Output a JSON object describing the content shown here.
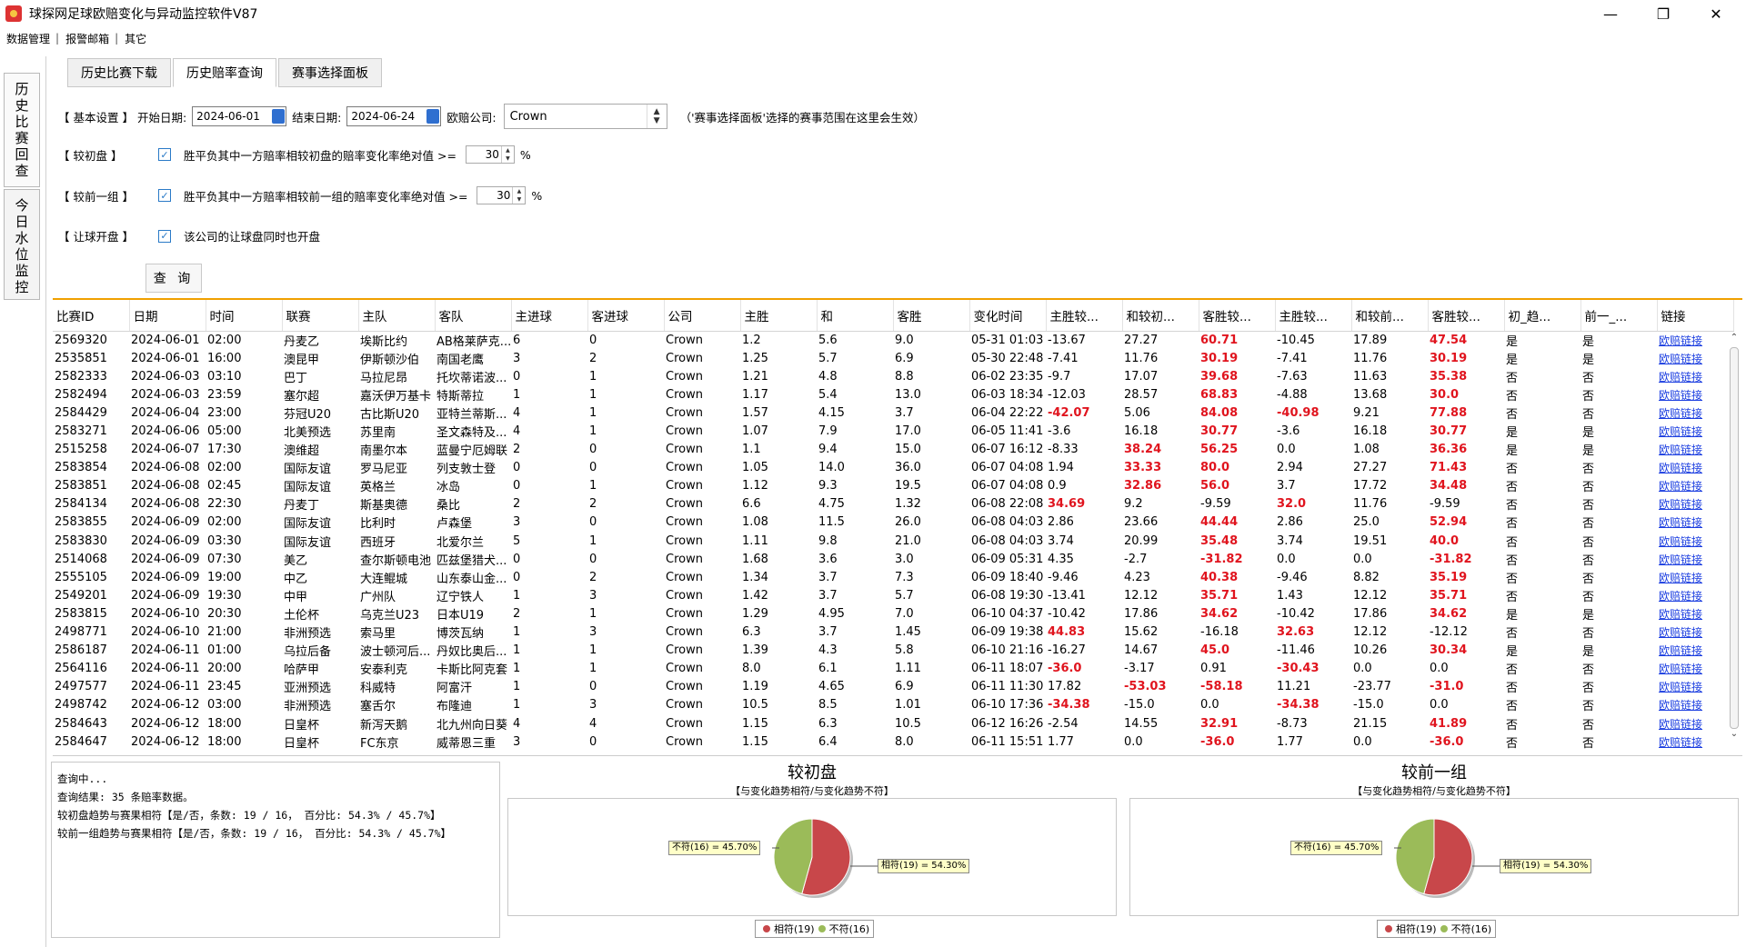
{
  "app": {
    "title": "球探网足球欧赔变化与异动监控软件V87"
  },
  "menu": [
    "数据管理",
    "报警邮箱",
    "其它"
  ],
  "vtabs": [
    "历史比赛回查",
    "今日水位监控"
  ],
  "tabs": [
    "历史比赛下载",
    "历史赔率查询",
    "赛事选择面板"
  ],
  "settings": {
    "basic_label": "【 基本设置 】",
    "start_label": "开始日期:",
    "start_date": "2024-06-01",
    "end_label": "结束日期:",
    "end_date": "2024-06-24",
    "company_label": "欧赔公司:",
    "company": "Crown",
    "note": "（'赛事选择面板'选择的赛事范围在这里会生效）",
    "initial_label": "【 较初盘 】",
    "initial_text": "胜平负其中一方赔率相较初盘的赔率变化率绝对值 >=",
    "initial_value": "30",
    "prev_label": "【 较前一组 】",
    "prev_text": "胜平负其中一方赔率相较前一组的赔率变化率绝对值 >=",
    "prev_value": "30",
    "percent": "%",
    "handicap_label": "【 让球开盘 】",
    "handicap_text": "该公司的让球盘同时也开盘",
    "query_button": "查 询"
  },
  "table": {
    "headers": [
      "比赛ID",
      "日期",
      "时间",
      "联赛",
      "主队",
      "客队",
      "主进球",
      "客进球",
      "公司",
      "主胜",
      "和",
      "客胜",
      "变化时间",
      "主胜较...",
      "和较初...",
      "客胜较...",
      "主胜较...",
      "和较前...",
      "客胜较...",
      "初_趋...",
      "前一_...",
      "链接"
    ],
    "red_cols": [
      13,
      14,
      15,
      16,
      17,
      18
    ],
    "link_text": "欧赔链接",
    "rows": [
      [
        "2569320",
        "2024-06-01",
        "02:00",
        "丹麦乙",
        "埃斯比约",
        "AB格莱萨克...",
        "6",
        "0",
        "Crown",
        "1.2",
        "5.6",
        "9.0",
        "05-31 01:03",
        "-13.67",
        "27.27",
        "60.71",
        "-10.45",
        "17.89",
        "47.54",
        "是",
        "是"
      ],
      [
        "2535851",
        "2024-06-01",
        "16:00",
        "澳昆甲",
        "伊斯顿沙伯",
        "南国老鹰",
        "3",
        "2",
        "Crown",
        "1.25",
        "5.7",
        "6.9",
        "05-30 22:48",
        "-7.41",
        "11.76",
        "30.19",
        "-7.41",
        "11.76",
        "30.19",
        "是",
        "是"
      ],
      [
        "2582333",
        "2024-06-03",
        "03:10",
        "巴丁",
        "马拉尼昂",
        "托坎蒂诺波...",
        "0",
        "1",
        "Crown",
        "1.21",
        "4.8",
        "8.8",
        "06-02 23:35",
        "-9.7",
        "17.07",
        "39.68",
        "-7.63",
        "11.63",
        "35.38",
        "否",
        "否"
      ],
      [
        "2582494",
        "2024-06-03",
        "23:59",
        "塞尔超",
        "嘉沃伊万基卡",
        "特斯蒂拉",
        "1",
        "1",
        "Crown",
        "1.17",
        "5.4",
        "13.0",
        "06-03 18:34",
        "-12.03",
        "28.57",
        "68.83",
        "-4.88",
        "13.68",
        "30.0",
        "否",
        "否"
      ],
      [
        "2584429",
        "2024-06-04",
        "23:00",
        "芬冠U20",
        "古比斯U20",
        "亚特兰蒂斯...",
        "4",
        "1",
        "Crown",
        "1.57",
        "4.15",
        "3.7",
        "06-04 22:22",
        "-42.07",
        "5.06",
        "84.08",
        "-40.98",
        "9.21",
        "77.88",
        "否",
        "否"
      ],
      [
        "2583271",
        "2024-06-06",
        "05:00",
        "北美预选",
        "苏里南",
        "圣文森特及...",
        "4",
        "1",
        "Crown",
        "1.07",
        "7.9",
        "17.0",
        "06-05 11:41",
        "-3.6",
        "16.18",
        "30.77",
        "-3.6",
        "16.18",
        "30.77",
        "是",
        "是"
      ],
      [
        "2515258",
        "2024-06-07",
        "17:30",
        "澳维超",
        "南墨尔本",
        "蓝曼宁厄姆联",
        "2",
        "0",
        "Crown",
        "1.1",
        "9.4",
        "15.0",
        "06-07 16:12",
        "-8.33",
        "38.24",
        "56.25",
        "0.0",
        "1.08",
        "36.36",
        "是",
        "是"
      ],
      [
        "2583854",
        "2024-06-08",
        "02:00",
        "国际友谊",
        "罗马尼亚",
        "列支敦士登",
        "0",
        "0",
        "Crown",
        "1.05",
        "14.0",
        "36.0",
        "06-07 04:08",
        "1.94",
        "33.33",
        "80.0",
        "2.94",
        "27.27",
        "71.43",
        "否",
        "否"
      ],
      [
        "2583851",
        "2024-06-08",
        "02:45",
        "国际友谊",
        "英格兰",
        "冰岛",
        "0",
        "1",
        "Crown",
        "1.12",
        "9.3",
        "19.5",
        "06-07 04:08",
        "0.9",
        "32.86",
        "56.0",
        "3.7",
        "17.72",
        "34.48",
        "否",
        "否"
      ],
      [
        "2584134",
        "2024-06-08",
        "22:30",
        "丹麦丁",
        "斯基奥德",
        "桑比",
        "2",
        "2",
        "Crown",
        "6.6",
        "4.75",
        "1.32",
        "06-08 22:08",
        "34.69",
        "9.2",
        "-9.59",
        "32.0",
        "11.76",
        "-9.59",
        "否",
        "否"
      ],
      [
        "2583855",
        "2024-06-09",
        "02:00",
        "国际友谊",
        "比利时",
        "卢森堡",
        "3",
        "0",
        "Crown",
        "1.08",
        "11.5",
        "26.0",
        "06-08 04:03",
        "2.86",
        "23.66",
        "44.44",
        "2.86",
        "25.0",
        "52.94",
        "否",
        "否"
      ],
      [
        "2583830",
        "2024-06-09",
        "03:30",
        "国际友谊",
        "西班牙",
        "北爱尔兰",
        "5",
        "1",
        "Crown",
        "1.11",
        "9.8",
        "21.0",
        "06-08 04:03",
        "3.74",
        "20.99",
        "35.48",
        "3.74",
        "19.51",
        "40.0",
        "否",
        "否"
      ],
      [
        "2514068",
        "2024-06-09",
        "07:30",
        "美乙",
        "查尔斯顿电池",
        "匹兹堡猎犬...",
        "0",
        "0",
        "Crown",
        "1.68",
        "3.6",
        "3.0",
        "06-09 05:31",
        "4.35",
        "-2.7",
        "-31.82",
        "0.0",
        "0.0",
        "-31.82",
        "否",
        "否"
      ],
      [
        "2555105",
        "2024-06-09",
        "19:00",
        "中乙",
        "大连鲲城",
        "山东泰山金...",
        "0",
        "2",
        "Crown",
        "1.34",
        "3.7",
        "7.3",
        "06-09 18:40",
        "-9.46",
        "4.23",
        "40.38",
        "-9.46",
        "8.82",
        "35.19",
        "否",
        "否"
      ],
      [
        "2549201",
        "2024-06-09",
        "19:30",
        "中甲",
        "广州队",
        "辽宁铁人",
        "1",
        "3",
        "Crown",
        "1.42",
        "3.7",
        "5.7",
        "06-08 19:30",
        "-13.41",
        "12.12",
        "35.71",
        "1.43",
        "12.12",
        "35.71",
        "否",
        "否"
      ],
      [
        "2583815",
        "2024-06-10",
        "20:30",
        "土伦杯",
        "乌克兰U23",
        "日本U19",
        "2",
        "1",
        "Crown",
        "1.29",
        "4.95",
        "7.0",
        "06-10 04:37",
        "-10.42",
        "17.86",
        "34.62",
        "-10.42",
        "17.86",
        "34.62",
        "是",
        "是"
      ],
      [
        "2498771",
        "2024-06-10",
        "21:00",
        "非洲预选",
        "索马里",
        "博茨瓦纳",
        "1",
        "3",
        "Crown",
        "6.3",
        "3.7",
        "1.45",
        "06-09 19:38",
        "44.83",
        "15.62",
        "-16.18",
        "32.63",
        "12.12",
        "-12.12",
        "否",
        "否"
      ],
      [
        "2586187",
        "2024-06-11",
        "01:00",
        "乌拉后备",
        "波士顿河后...",
        "丹奴比奥后...",
        "1",
        "1",
        "Crown",
        "1.39",
        "4.3",
        "5.8",
        "06-10 21:16",
        "-16.27",
        "14.67",
        "45.0",
        "-11.46",
        "10.26",
        "30.34",
        "是",
        "是"
      ],
      [
        "2564116",
        "2024-06-11",
        "20:00",
        "哈萨甲",
        "安泰利克",
        "卡斯比阿克套",
        "1",
        "1",
        "Crown",
        "8.0",
        "6.1",
        "1.11",
        "06-11 18:07",
        "-36.0",
        "-3.17",
        "0.91",
        "-30.43",
        "0.0",
        "0.0",
        "否",
        "否"
      ],
      [
        "2497577",
        "2024-06-11",
        "23:45",
        "亚洲预选",
        "科威特",
        "阿富汗",
        "1",
        "0",
        "Crown",
        "1.19",
        "4.65",
        "6.9",
        "06-11 11:30",
        "17.82",
        "-53.03",
        "-58.18",
        "11.21",
        "-23.77",
        "-31.0",
        "否",
        "否"
      ],
      [
        "2498742",
        "2024-06-12",
        "03:00",
        "非洲预选",
        "塞舌尔",
        "布隆迪",
        "1",
        "3",
        "Crown",
        "10.5",
        "8.5",
        "1.01",
        "06-10 17:36",
        "-34.38",
        "-15.0",
        "0.0",
        "-34.38",
        "-15.0",
        "0.0",
        "否",
        "否"
      ],
      [
        "2584643",
        "2024-06-12",
        "18:00",
        "日皇杯",
        "新泻天鹅",
        "北九州向日葵",
        "4",
        "4",
        "Crown",
        "1.15",
        "6.3",
        "10.5",
        "06-12 16:26",
        "-2.54",
        "14.55",
        "32.91",
        "-8.73",
        "21.15",
        "41.89",
        "否",
        "否"
      ],
      [
        "2584647",
        "2024-06-12",
        "18:00",
        "日皇杯",
        "FC东京",
        "威蒂恩三重",
        "3",
        "0",
        "Crown",
        "1.15",
        "6.4",
        "8.0",
        "06-11 15:51",
        "1.77",
        "0.0",
        "-36.0",
        "1.77",
        "0.0",
        "-36.0",
        "否",
        "否"
      ]
    ]
  },
  "log": {
    "lines": [
      "查询中...",
      "查询结果: 35 条赔率数据。",
      "较初盘趋势与赛果相符【是/否，条数: 19 / 16， 百分比: 54.3% / 45.7%】",
      "较前一组趋势与赛果相符【是/否，条数: 19 / 16， 百分比: 54.3% / 45.7%】"
    ]
  },
  "charts": [
    {
      "title": "较初盘",
      "subtitle": "【与变化趋势相符/与变化趋势不符】",
      "label_left": "不符(16) = 45.70%",
      "label_right": "相符(19) = 54.30%",
      "legend_a": "相符(19)",
      "legend_b": "不符(16)"
    },
    {
      "title": "较前一组",
      "subtitle": "【与变化趋势相符/与变化趋势不符】",
      "label_left": "不符(16) = 45.70%",
      "label_right": "相符(19) = 54.30%",
      "legend_a": "相符(19)",
      "legend_b": "不符(16)"
    }
  ],
  "chart_data": [
    {
      "type": "pie",
      "title": "较初盘",
      "subtitle": "【与变化趋势相符/与变化趋势不符】",
      "categories": [
        "相符",
        "不符"
      ],
      "counts": [
        19,
        16
      ],
      "values": [
        54.3,
        45.7
      ],
      "colors": [
        "#c8474a",
        "#9bbb59"
      ]
    },
    {
      "type": "pie",
      "title": "较前一组",
      "subtitle": "【与变化趋势相符/与变化趋势不符】",
      "categories": [
        "相符",
        "不符"
      ],
      "counts": [
        19,
        16
      ],
      "values": [
        54.3,
        45.7
      ],
      "colors": [
        "#c8474a",
        "#9bbb59"
      ]
    }
  ]
}
